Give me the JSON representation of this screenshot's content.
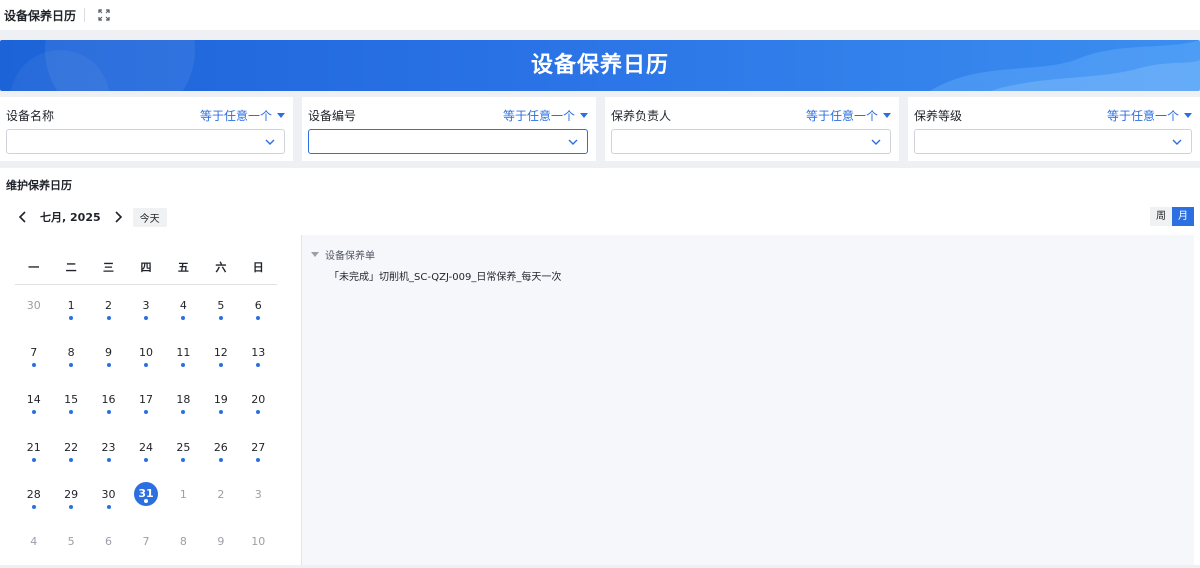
{
  "topbar": {
    "title": "设备保养日历",
    "fullscreen_icon": "fullscreen-icon"
  },
  "banner": {
    "title": "设备保养日历"
  },
  "filters": [
    {
      "label": "设备名称",
      "operator": "等于任意一个",
      "value": ""
    },
    {
      "label": "设备编号",
      "operator": "等于任意一个",
      "value": ""
    },
    {
      "label": "保养负责人",
      "operator": "等于任意一个",
      "value": ""
    },
    {
      "label": "保养等级",
      "operator": "等于任意一个",
      "value": ""
    }
  ],
  "calendar": {
    "section_title": "维护保养日历",
    "month_label": "七月, 2025",
    "today_label": "今天",
    "views": {
      "week": "周",
      "month": "月",
      "active": "month"
    },
    "weekdays": [
      "一",
      "二",
      "三",
      "四",
      "五",
      "六",
      "日"
    ],
    "weeks": [
      [
        {
          "d": "30",
          "other": true,
          "dot": false
        },
        {
          "d": "1",
          "other": false,
          "dot": true
        },
        {
          "d": "2",
          "other": false,
          "dot": true
        },
        {
          "d": "3",
          "other": false,
          "dot": true
        },
        {
          "d": "4",
          "other": false,
          "dot": true
        },
        {
          "d": "5",
          "other": false,
          "dot": true
        },
        {
          "d": "6",
          "other": false,
          "dot": true
        }
      ],
      [
        {
          "d": "7",
          "other": false,
          "dot": true
        },
        {
          "d": "8",
          "other": false,
          "dot": true
        },
        {
          "d": "9",
          "other": false,
          "dot": true
        },
        {
          "d": "10",
          "other": false,
          "dot": true
        },
        {
          "d": "11",
          "other": false,
          "dot": true
        },
        {
          "d": "12",
          "other": false,
          "dot": true
        },
        {
          "d": "13",
          "other": false,
          "dot": true
        }
      ],
      [
        {
          "d": "14",
          "other": false,
          "dot": true
        },
        {
          "d": "15",
          "other": false,
          "dot": true
        },
        {
          "d": "16",
          "other": false,
          "dot": true
        },
        {
          "d": "17",
          "other": false,
          "dot": true
        },
        {
          "d": "18",
          "other": false,
          "dot": true
        },
        {
          "d": "19",
          "other": false,
          "dot": true
        },
        {
          "d": "20",
          "other": false,
          "dot": true
        }
      ],
      [
        {
          "d": "21",
          "other": false,
          "dot": true
        },
        {
          "d": "22",
          "other": false,
          "dot": true
        },
        {
          "d": "23",
          "other": false,
          "dot": true
        },
        {
          "d": "24",
          "other": false,
          "dot": true
        },
        {
          "d": "25",
          "other": false,
          "dot": true
        },
        {
          "d": "26",
          "other": false,
          "dot": true
        },
        {
          "d": "27",
          "other": false,
          "dot": true
        }
      ],
      [
        {
          "d": "28",
          "other": false,
          "dot": true
        },
        {
          "d": "29",
          "other": false,
          "dot": true
        },
        {
          "d": "30",
          "other": false,
          "dot": true
        },
        {
          "d": "31",
          "other": false,
          "dot": true,
          "selected": true
        },
        {
          "d": "1",
          "other": true,
          "dot": false
        },
        {
          "d": "2",
          "other": true,
          "dot": false
        },
        {
          "d": "3",
          "other": true,
          "dot": false
        }
      ],
      [
        {
          "d": "4",
          "other": true,
          "dot": false
        },
        {
          "d": "5",
          "other": true,
          "dot": false
        },
        {
          "d": "6",
          "other": true,
          "dot": false
        },
        {
          "d": "7",
          "other": true,
          "dot": false
        },
        {
          "d": "8",
          "other": true,
          "dot": false
        },
        {
          "d": "9",
          "other": true,
          "dot": false
        },
        {
          "d": "10",
          "other": true,
          "dot": false
        }
      ]
    ]
  },
  "events": {
    "group_label": "设备保养单",
    "items": [
      "「未完成」切削机_SC-QZJ-009_日常保养_每天一次"
    ]
  },
  "colors": {
    "accent": "#2c6fe0",
    "banner": "#2a73e6",
    "muted": "#9aa0a8"
  }
}
